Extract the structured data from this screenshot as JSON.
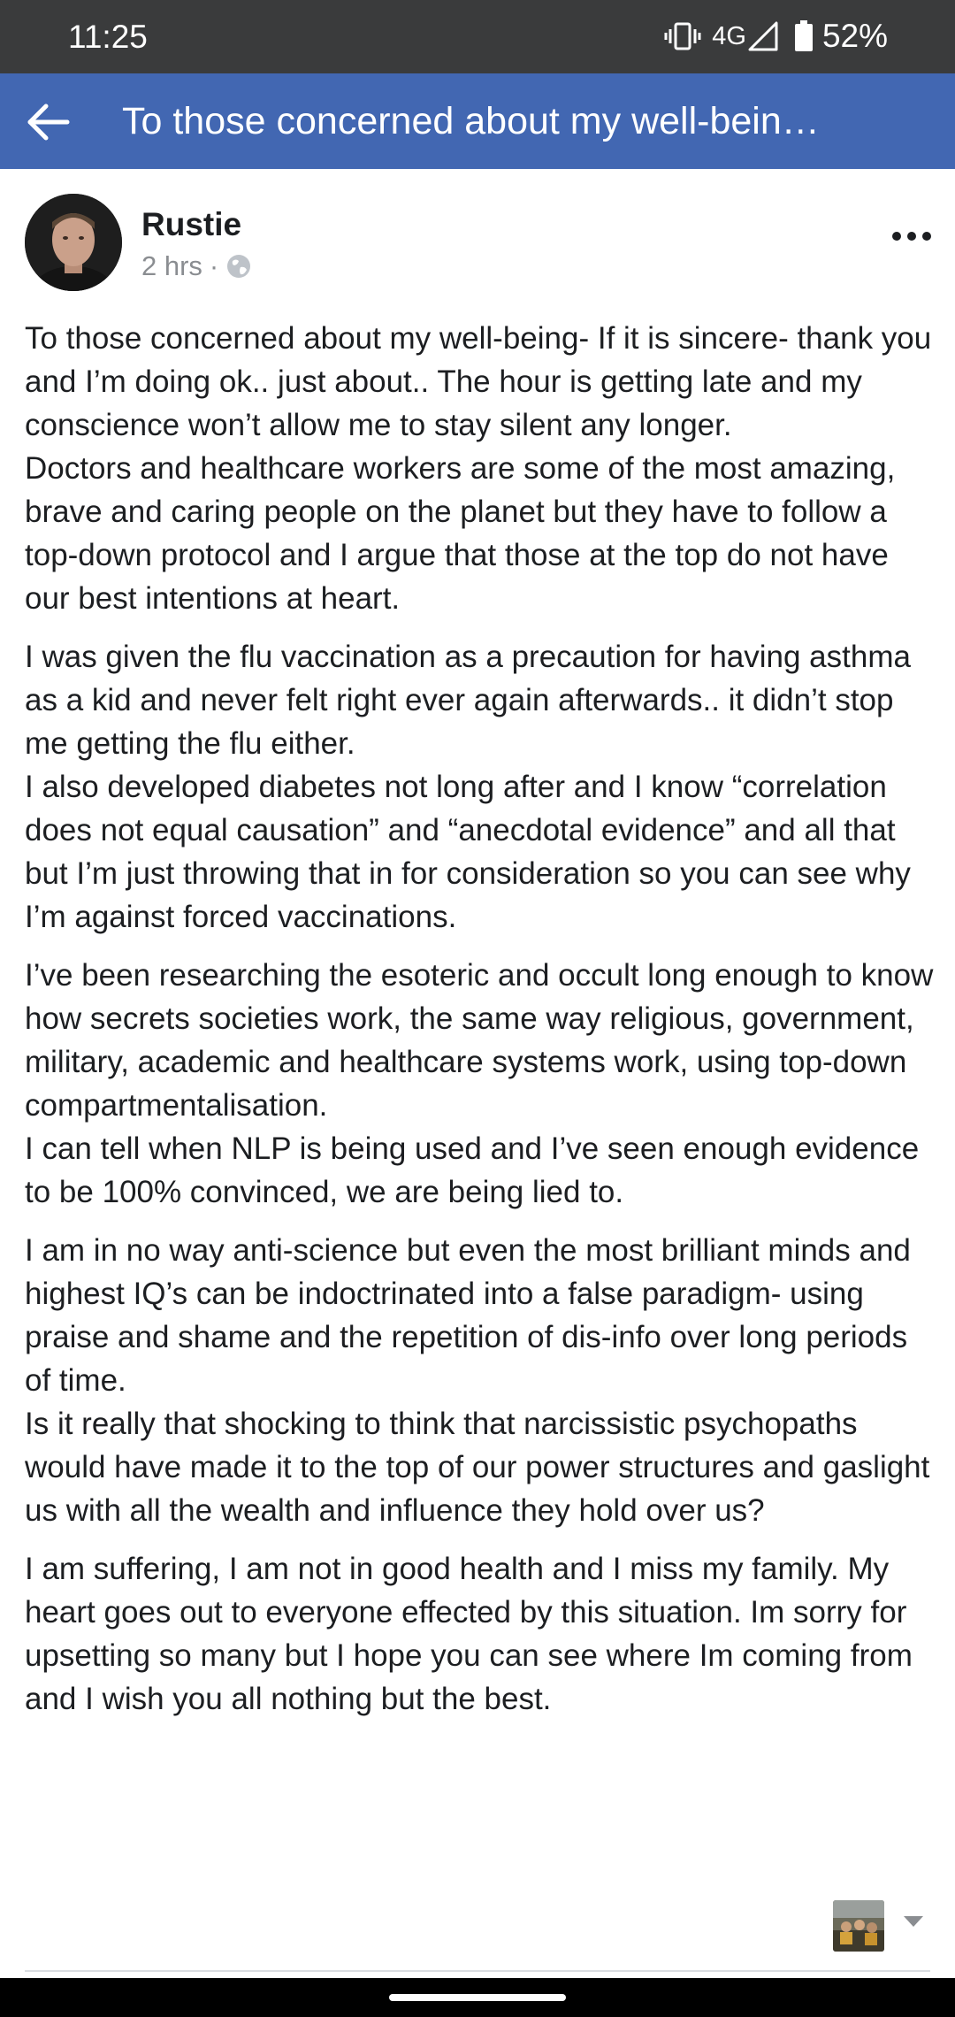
{
  "status_bar": {
    "time": "11:25",
    "network": "4G",
    "battery": "52%",
    "icons": [
      "vibrate-icon",
      "signal-icon",
      "battery-icon"
    ]
  },
  "app_bar": {
    "back_icon": "arrow-left-icon",
    "title": "To those concerned about my well-bein…",
    "color": "#4267b2"
  },
  "post": {
    "author": "Rustie",
    "time": "2 hrs",
    "separator": "·",
    "privacy_icon": "globe-icon",
    "more_icon": "more-horizontal-icon",
    "paragraphs": [
      "To those concerned about my well-being- If it is sincere- thank you and I’m doing ok.. just about.. The hour is getting late and my conscience won’t allow me to stay silent any longer.\nDoctors and healthcare workers are some of the most amazing, brave and caring people on the planet but they have to follow a top-down protocol and I argue that those at the top do not have our best intentions at heart.",
      "I was given the flu vaccination as a precaution for having asthma as a kid and never felt right ever again afterwards.. it didn’t stop me getting the flu either.\nI also developed diabetes not long after and I know “correlation does not equal causation” and “anecdotal evidence” and all that but I’m just throwing that in for consideration so you can see why I’m against forced vaccinations.",
      "I’ve been researching the esoteric and occult long enough to know how secrets societies work, the same way religious, government, military, academic and healthcare systems work, using top-down compartmentalisation.\nI can tell when NLP is being used and I’ve seen enough evidence to be 100% convinced, we are being lied to.",
      "I am in no way anti-science but even the most brilliant minds and highest IQ’s can be indoctrinated into a false paradigm- using praise and shame and the repetition of dis-info over long periods of time.\nIs it really that shocking to think that narcissistic psychopaths would have made it to the top of our power structures and gaslight us with all the wealth and influence they hold over us?",
      "I am suffering, I am not in good health and I miss my family. My heart goes out to everyone effected by this situation. Im sorry for upsetting so many but I hope you can see where Im coming from and I wish you all nothing but the best."
    ]
  },
  "reaction": {
    "thumbnail_icon": "profile-thumbnail",
    "dropdown_icon": "chevron-down-icon"
  }
}
